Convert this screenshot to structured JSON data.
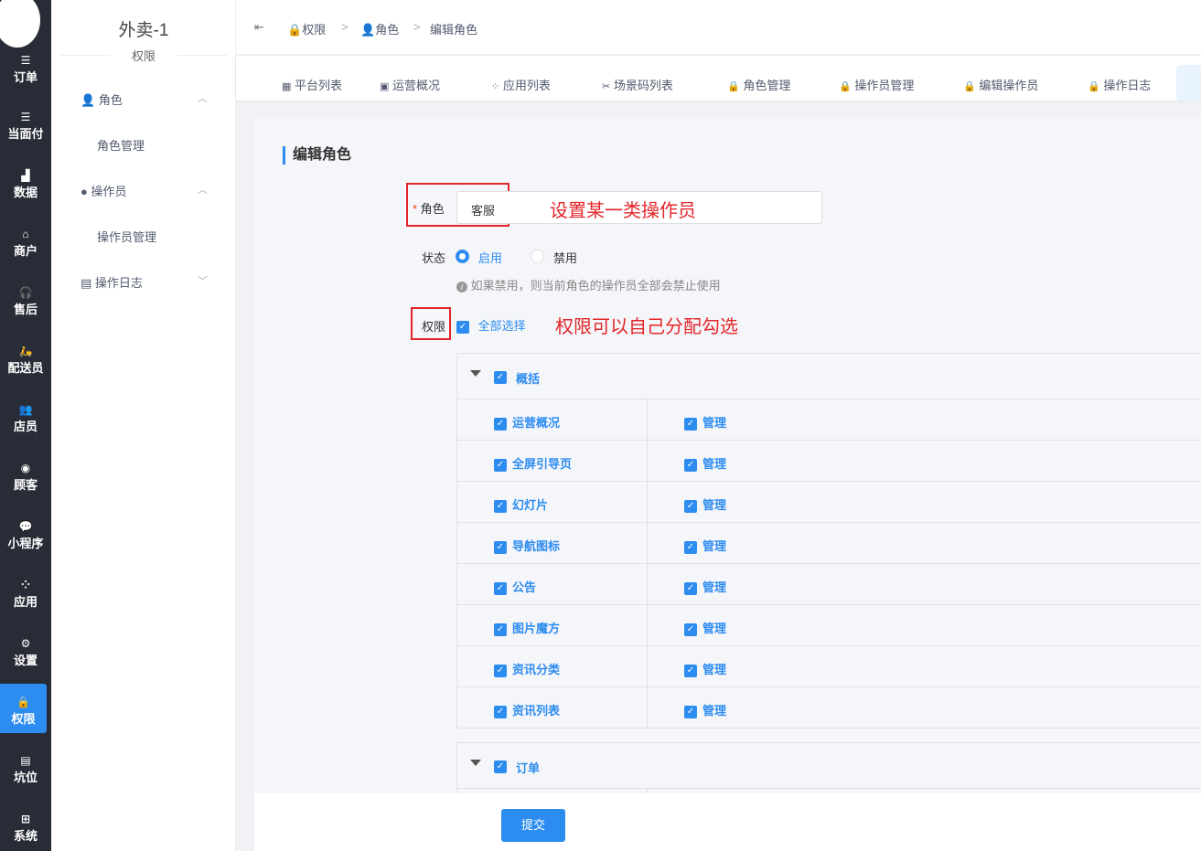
{
  "nav": {
    "items": [
      {
        "icon": "list-icon",
        "label": "订单"
      },
      {
        "icon": "list-icon",
        "label": "当面付"
      },
      {
        "icon": "bar-chart-icon",
        "label": "数据"
      },
      {
        "icon": "store-icon",
        "label": "商户"
      },
      {
        "icon": "headset-icon",
        "label": "售后"
      },
      {
        "icon": "scooter-icon",
        "label": "配送员"
      },
      {
        "icon": "users-icon",
        "label": "店员"
      },
      {
        "icon": "user-circle-icon",
        "label": "顾客"
      },
      {
        "icon": "wechat-icon",
        "label": "小程序"
      },
      {
        "icon": "apps-icon",
        "label": "应用"
      },
      {
        "icon": "user-settings-icon",
        "label": "设置"
      },
      {
        "icon": "lock-icon",
        "label": "权限"
      },
      {
        "icon": "report-icon",
        "label": "坑位"
      },
      {
        "icon": "windows-icon",
        "label": "系统"
      }
    ],
    "active": "权限"
  },
  "sub": {
    "shop": "外卖-1",
    "title": "权限",
    "groups": [
      {
        "label": "角色",
        "items": [
          "角色管理"
        ]
      },
      {
        "label": "操作员",
        "items": [
          "操作员管理"
        ]
      },
      {
        "label": "操作日志",
        "items": []
      }
    ]
  },
  "breadcrumb": [
    "权限",
    "角色",
    "编辑角色"
  ],
  "tabs": [
    "平台列表",
    "运营概况",
    "应用列表",
    "场景码列表",
    "角色管理",
    "操作员管理",
    "编辑操作员",
    "操作日志"
  ],
  "form": {
    "title": "编辑角色",
    "role_label": "角色",
    "role_value": "客服",
    "status_label": "状态",
    "status_options": [
      "启用",
      "禁用"
    ],
    "status_selected": "启用",
    "status_hint": "如果禁用，则当前角色的操作员全部会禁止使用",
    "perm_label": "权限",
    "select_all": "全部选择",
    "select_all_checked": true
  },
  "annotations": {
    "role": "设置某一类操作员",
    "perm": "权限可以自己分配勾选"
  },
  "tree": [
    {
      "label": "概括",
      "checked": true,
      "children": [
        {
          "label": "运营概况",
          "action": "管理"
        },
        {
          "label": "全屏引导页",
          "action": "管理"
        },
        {
          "label": "幻灯片",
          "action": "管理"
        },
        {
          "label": "导航图标",
          "action": "管理"
        },
        {
          "label": "公告",
          "action": "管理"
        },
        {
          "label": "图片魔方",
          "action": "管理"
        },
        {
          "label": "资讯分类",
          "action": "管理"
        },
        {
          "label": "资讯列表",
          "action": "管理"
        }
      ]
    },
    {
      "label": "订单",
      "checked": true,
      "children": []
    }
  ],
  "submit": "提交",
  "colors": {
    "primary": "#2d8cf0",
    "nav_bg": "#282c37",
    "annotation": "#e3262a"
  }
}
